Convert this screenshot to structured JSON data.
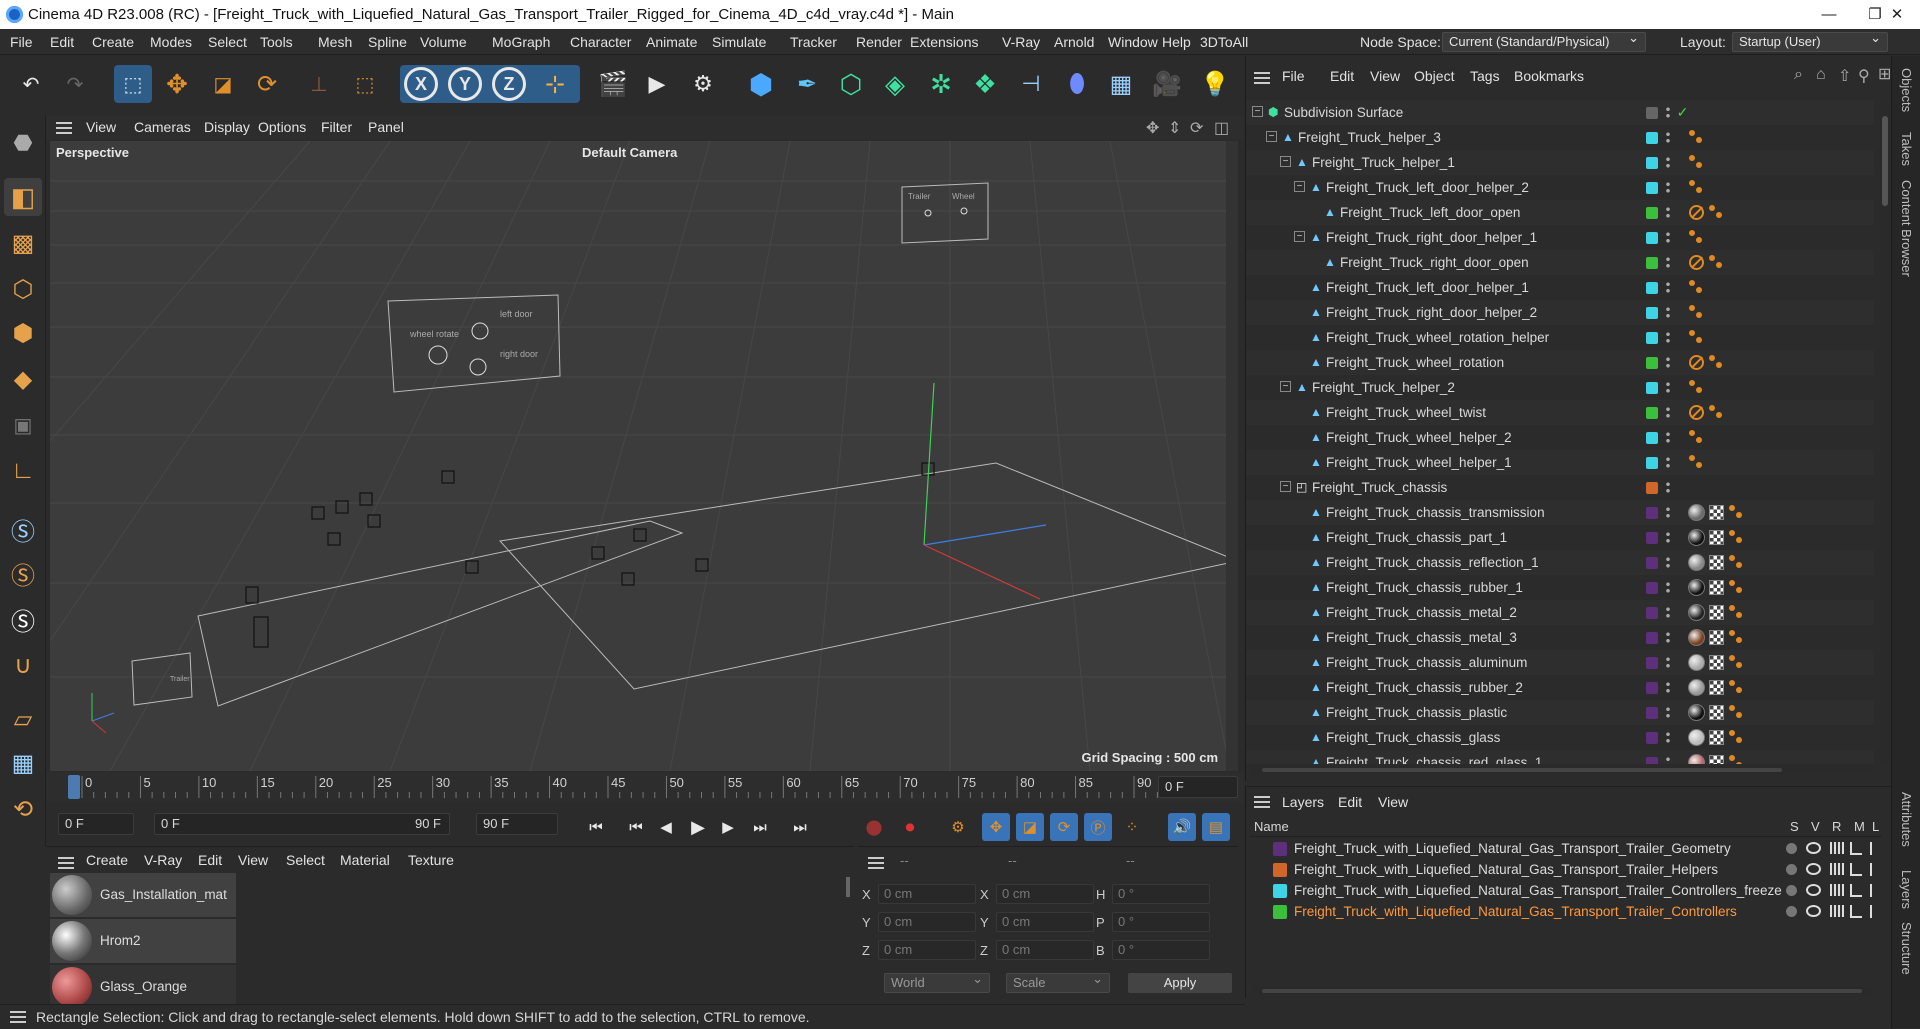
{
  "titlebar": {
    "title": "Cinema 4D R23.008 (RC) - [Freight_Truck_with_Liquefied_Natural_Gas_Transport_Trailer_Rigged_for_Cinema_4D_c4d_vray.c4d *] - Main",
    "min": "—",
    "max": "❐",
    "close": "✕"
  },
  "menu": [
    "File",
    "Edit",
    "Create",
    "Modes",
    "Select",
    "Tools",
    "Mesh",
    "Spline",
    "Volume",
    "MoGraph",
    "Character",
    "Animate",
    "Simulate",
    "Tracker",
    "Render",
    "Extensions",
    "V-Ray",
    "Arnold",
    "Window",
    "Help",
    "3DToAll"
  ],
  "nodespace": {
    "label": "Node Space:",
    "value": "Current (Standard/Physical)"
  },
  "layout": {
    "label": "Layout:",
    "value": "Startup (User)"
  },
  "toolbar": {
    "icons": [
      "undo-icon",
      "redo-icon",
      "live-selection-icon",
      "move-icon",
      "scale-icon",
      "rotate-icon",
      "recent-tool-icon",
      "rectangle-selection-icon",
      "x-axis-icon",
      "y-axis-icon",
      "z-axis-icon",
      "coordinate-system-icon",
      "render-view-icon",
      "render-icon",
      "render-settings-icon",
      "cube-icon",
      "pen-icon",
      "subdivision-icon",
      "extrude-icon",
      "mograph-cloner-icon",
      "array-icon",
      "deformer-icon",
      "field-icon",
      "floor-icon",
      "camera-icon",
      "light-icon"
    ],
    "x": "X",
    "y": "Y",
    "z": "Z"
  },
  "viewport": {
    "menu": [
      "View",
      "Cameras",
      "Display",
      "Options",
      "Filter",
      "Panel"
    ],
    "label": "Perspective",
    "camera": "Default Camera",
    "grid": "Grid Spacing : 500 cm"
  },
  "timeline": {
    "ticks": [
      "0",
      "5",
      "10",
      "15",
      "20",
      "25",
      "30",
      "35",
      "40",
      "45",
      "50",
      "55",
      "60",
      "65",
      "70",
      "75",
      "80",
      "85",
      "90"
    ],
    "frame": "0 F"
  },
  "transport": {
    "start": "0 F",
    "range_start": "0 F",
    "range_end": "90 F",
    "end": "90 F"
  },
  "materials": {
    "menu": [
      "Create",
      "V-Ray",
      "Edit",
      "View",
      "Select",
      "Material",
      "Texture"
    ],
    "items": [
      "Gas_Installation_mat",
      "Hrom2",
      "Glass_Orange"
    ]
  },
  "attributes": {
    "dash1": "--",
    "dash2": "--",
    "dash3": "--",
    "labels": [
      "X",
      "Y",
      "Z",
      "X",
      "Y",
      "Z",
      "H",
      "P",
      "B"
    ],
    "values": [
      "0 cm",
      "0 cm",
      "0 cm",
      "0 cm",
      "0 cm",
      "0 cm",
      "0 °",
      "0 °",
      "0 °"
    ],
    "world": "World",
    "scale": "Scale",
    "apply": "Apply"
  },
  "status": "Rectangle Selection: Click and drag to rectangle-select elements. Hold down SHIFT to add to the selection, CTRL to remove.",
  "objects": {
    "menu": [
      "File",
      "Edit",
      "View",
      "Object",
      "Tags",
      "Bookmarks"
    ],
    "rows": [
      {
        "name": "Subdivision Surface",
        "d": 0,
        "c": "#666666",
        "t": "check"
      },
      {
        "name": "Freight_Truck_helper_3",
        "d": 1,
        "c": "#3fd3e6",
        "t": "b"
      },
      {
        "name": "Freight_Truck_helper_1",
        "d": 2,
        "c": "#3fd3e6",
        "t": "b"
      },
      {
        "name": "Freight_Truck_left_door_helper_2",
        "d": 3,
        "c": "#3fd3e6",
        "t": "b"
      },
      {
        "name": "Freight_Truck_left_door_open",
        "d": 4,
        "c": "#3cbf3c",
        "t": "nb"
      },
      {
        "name": "Freight_Truck_right_door_helper_1",
        "d": 3,
        "c": "#3fd3e6",
        "t": "b"
      },
      {
        "name": "Freight_Truck_right_door_open",
        "d": 4,
        "c": "#3cbf3c",
        "t": "nb"
      },
      {
        "name": "Freight_Truck_left_door_helper_1",
        "d": 3,
        "c": "#3fd3e6",
        "t": "b"
      },
      {
        "name": "Freight_Truck_right_door_helper_2",
        "d": 3,
        "c": "#3fd3e6",
        "t": "b"
      },
      {
        "name": "Freight_Truck_wheel_rotation_helper",
        "d": 3,
        "c": "#3fd3e6",
        "t": "b"
      },
      {
        "name": "Freight_Truck_wheel_rotation",
        "d": 3,
        "c": "#3cbf3c",
        "t": "nb"
      },
      {
        "name": "Freight_Truck_helper_2",
        "d": 2,
        "c": "#3fd3e6",
        "t": "b"
      },
      {
        "name": "Freight_Truck_wheel_twist",
        "d": 3,
        "c": "#3cbf3c",
        "t": "nb"
      },
      {
        "name": "Freight_Truck_wheel_helper_2",
        "d": 3,
        "c": "#3fd3e6",
        "t": "b"
      },
      {
        "name": "Freight_Truck_wheel_helper_1",
        "d": 3,
        "c": "#3fd3e6",
        "t": "b"
      },
      {
        "name": "Freight_Truck_chassis",
        "d": 2,
        "c": "#d0662a",
        "t": "none"
      },
      {
        "name": "Freight_Truck_chassis_transmission",
        "d": 3,
        "c": "#5e2f7a",
        "t": "m"
      },
      {
        "name": "Freight_Truck_chassis_part_1",
        "d": 3,
        "c": "#5e2f7a",
        "t": "m"
      },
      {
        "name": "Freight_Truck_chassis_reflection_1",
        "d": 3,
        "c": "#5e2f7a",
        "t": "m"
      },
      {
        "name": "Freight_Truck_chassis_rubber_1",
        "d": 3,
        "c": "#5e2f7a",
        "t": "m"
      },
      {
        "name": "Freight_Truck_chassis_metal_2",
        "d": 3,
        "c": "#5e2f7a",
        "t": "m"
      },
      {
        "name": "Freight_Truck_chassis_metal_3",
        "d": 3,
        "c": "#5e2f7a",
        "t": "m"
      },
      {
        "name": "Freight_Truck_chassis_aluminum",
        "d": 3,
        "c": "#5e2f7a",
        "t": "m"
      },
      {
        "name": "Freight_Truck_chassis_rubber_2",
        "d": 3,
        "c": "#5e2f7a",
        "t": "m"
      },
      {
        "name": "Freight_Truck_chassis_plastic",
        "d": 3,
        "c": "#5e2f7a",
        "t": "m"
      },
      {
        "name": "Freight_Truck_chassis_glass",
        "d": 3,
        "c": "#5e2f7a",
        "t": "m"
      },
      {
        "name": "Freight_Truck_chassis_red_glass_1",
        "d": 3,
        "c": "#5e2f7a",
        "t": "m"
      }
    ]
  },
  "layers": {
    "menu": [
      "Layers",
      "Edit",
      "View"
    ],
    "cols": [
      "Name",
      "S",
      "V",
      "R",
      "M",
      "L"
    ],
    "rows": [
      {
        "name": "Freight_Truck_with_Liquefied_Natural_Gas_Transport_Trailer_Geometry",
        "c": "#5e2f7a",
        "hl": false
      },
      {
        "name": "Freight_Truck_with_Liquefied_Natural_Gas_Transport_Trailer_Helpers",
        "c": "#d0662a",
        "hl": false
      },
      {
        "name": "Freight_Truck_with_Liquefied_Natural_Gas_Transport_Trailer_Controllers_freeze",
        "c": "#3fd3e6",
        "hl": false
      },
      {
        "name": "Freight_Truck_with_Liquefied_Natural_Gas_Transport_Trailer_Controllers",
        "c": "#3cbf3c",
        "hl": true
      }
    ]
  },
  "sidetabs": [
    "Objects",
    "Takes",
    "Content Browser",
    "Attributes",
    "Layers",
    "Structure"
  ],
  "scene": {
    "ctrl1": [
      "left door",
      "wheel rotate",
      "right door"
    ],
    "ctrl2": [
      "Trailer",
      "Wheel"
    ],
    "ctrl3": "Trailer"
  }
}
